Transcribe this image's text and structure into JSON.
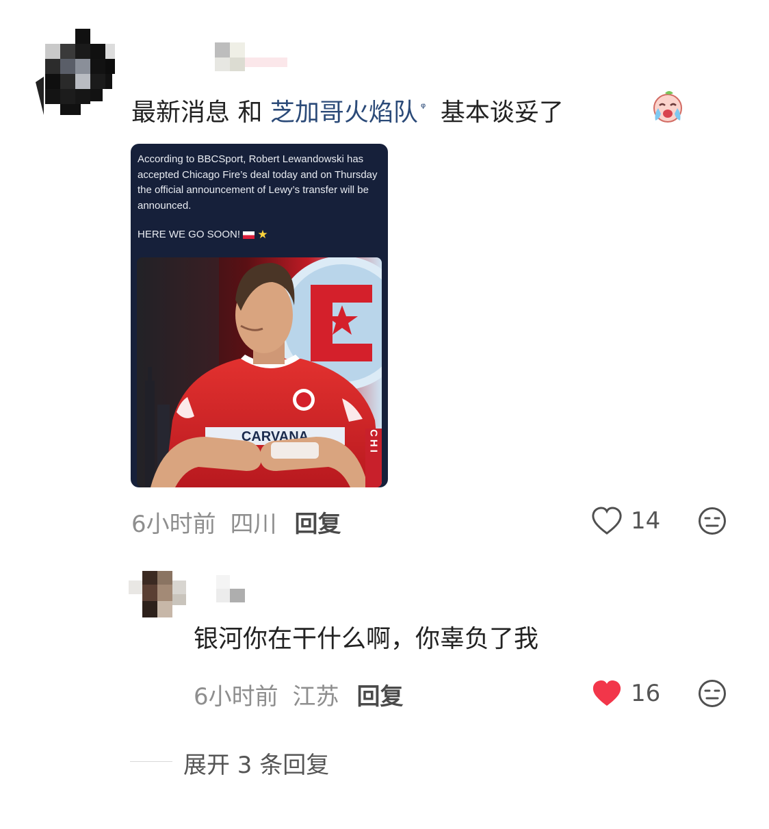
{
  "comment": {
    "text_before": "最新消息 和 ",
    "topic_link": "芝加哥火焰队",
    "search_mark": "ᵠ",
    "text_after": " 基本谈妥了",
    "emoji": "crying-face-emoji",
    "image": {
      "tweet_text": "According to BBCSport, Robert Lewandowski has accepted Chicago Fire’s deal today and on Thursday the official announcement of Lewy’s transfer will be announced.",
      "tweet_cta": "HERE WE GO SOON! ",
      "photo_sponsor": "CARVANA",
      "photo_scarf": "CHI"
    },
    "time": "6小时前",
    "location": "四川",
    "reply_label": "回复",
    "likes": "14",
    "liked": false
  },
  "reply": {
    "text": "银河你在干什么啊，你辜负了我",
    "time": "6小时前",
    "location": "江苏",
    "reply_label": "回复",
    "likes": "16",
    "liked": true
  },
  "expand": {
    "label": "展开 3 条回复"
  },
  "colors": {
    "topic": "#2b4a78",
    "like_active": "#f2364a",
    "meta": "#8e8e8e",
    "card_bg": "#16203a",
    "team_red": "#c8202b"
  }
}
